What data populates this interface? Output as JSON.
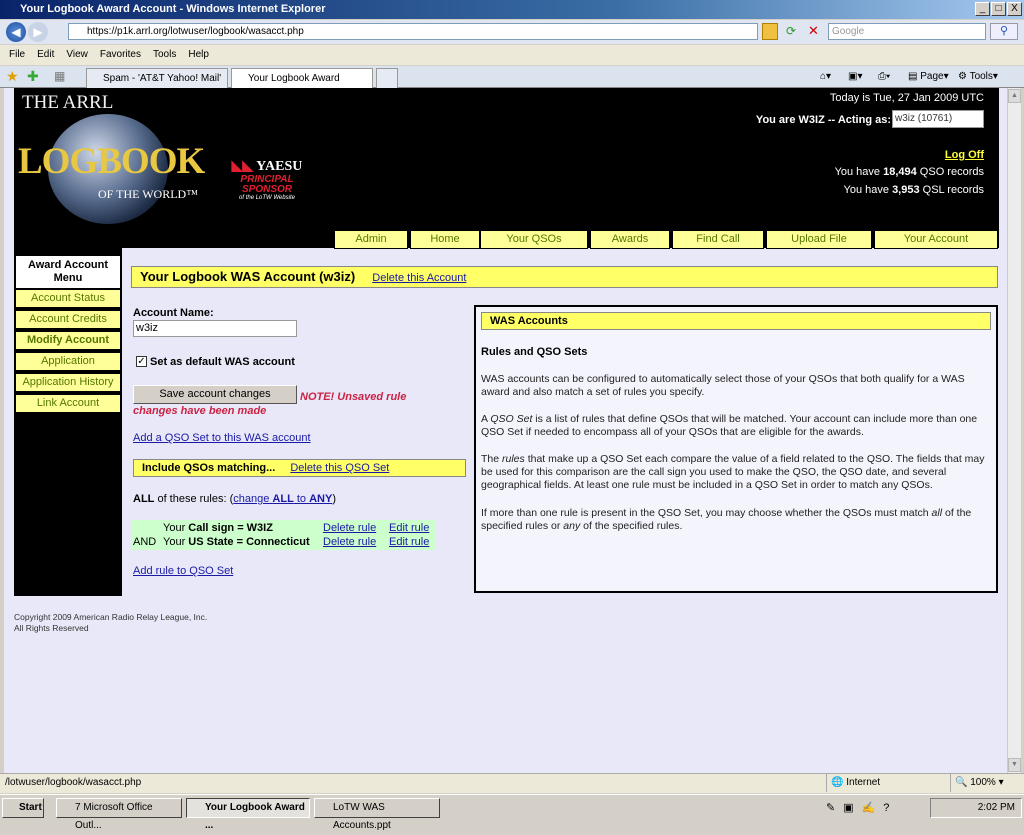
{
  "window": {
    "title": "Your Logbook Award Account - Windows Internet Explorer",
    "url": "https://p1k.arrl.org/lotwuser/logbook/wasacct.php",
    "search_placeholder": "Google"
  },
  "menu": [
    "File",
    "Edit",
    "View",
    "Favorites",
    "Tools",
    "Help"
  ],
  "tabs": [
    {
      "label": "Spam - 'AT&T Yahoo! Mail'"
    },
    {
      "label": "Your Logbook Award Acc..."
    }
  ],
  "command_bar": {
    "page": "Page",
    "tools": "Tools"
  },
  "header": {
    "logo_text": "THE ARRL LOGBOOK OF THE WORLD",
    "sponsor": "YAESU PRINCIPAL SPONSOR of the LoTW Website",
    "today": "Today is Tue, 27 Jan 2009 UTC",
    "you_are": "You are W3IZ -- Acting as:",
    "acting_as": "w3iz  (10761)",
    "log_off": "Log Off",
    "qso_prefix": "You have ",
    "qso_count": "18,494",
    "qso_suffix": " QSO records",
    "qsl_prefix": "You have ",
    "qsl_count": "3,953",
    "qsl_suffix": " QSL records"
  },
  "nav": [
    "Admin",
    "Home",
    "Your QSOs",
    "Awards",
    "Find Call",
    "Upload File",
    "Your Account"
  ],
  "sidebar": {
    "title": "Award Account Menu",
    "items": [
      "Account Status",
      "Account Credits",
      "Modify Account",
      "Application",
      "Application History",
      "Link Account"
    ],
    "active": "Modify Account"
  },
  "main": {
    "title": "Your Logbook WAS Account (w3iz)",
    "delete_account": "Delete this Account",
    "account_name_label": "Account Name:",
    "account_name_value": "w3iz",
    "default_checkbox_label": "Set as default WAS account",
    "default_checked": true,
    "save_button": "Save account changes",
    "note": "NOTE! Unsaved rule changes have been made",
    "add_qso_set": "Add a QSO Set to this WAS account",
    "qso_set_title": "Include QSOs matching...",
    "delete_qso_set": "Delete this QSO Set",
    "all_label": "ALL",
    "rules_text": " of these rules: (",
    "change_link_pre": "change ",
    "change_all": "ALL",
    "change_to": " to ",
    "change_any": "ANY",
    "rules_close": ")",
    "rules": [
      {
        "conj": "",
        "prefix": "Your ",
        "field": "Call sign = W3IZ",
        "delete": "Delete rule",
        "edit": "Edit rule"
      },
      {
        "conj": "AND",
        "prefix": "Your ",
        "field": "US State = Connecticut",
        "delete": "Delete rule",
        "edit": "Edit rule"
      }
    ],
    "add_rule": "Add rule to QSO Set"
  },
  "help": {
    "title": "WAS Accounts",
    "subtitle": "Rules and QSO Sets",
    "p1": "WAS accounts can be configured to automatically select those of your QSOs that both qualify for a WAS award and also match a set of rules you specify.",
    "p2a": "A ",
    "p2i": "QSO Set",
    "p2b": " is a list of rules that define QSOs that will be matched. Your account can include more than one QSO Set if needed to encompass all of your QSOs that are eligible for the awards.",
    "p3a": "The ",
    "p3i": "rules",
    "p3b": " that make up a QSO Set each compare the value of a field related to the QSO. The fields that may be used for this comparison are the call sign you used to make the QSO, the QSO date, and several geographical fields. At least one rule must be included in a QSO Set in order to match any QSOs.",
    "p4a": "If more than one rule is present in the QSO Set, you may choose whether the QSOs must match ",
    "p4i": "all",
    "p4b": " of the specified rules or ",
    "p4i2": "any",
    "p4c": " of the specified rules."
  },
  "footer": {
    "copyright": "Copyright 2009 American Radio Relay League, Inc.",
    "rights": "All Rights Reserved"
  },
  "statusbar": {
    "url": "/lotwuser/logbook/wasacct.php",
    "zone": "Internet",
    "zoom": "100%"
  },
  "taskbar": {
    "start": "Start",
    "items": [
      "7 Microsoft Office Outl...",
      "Your Logbook Award ...",
      "LoTW WAS Accounts.ppt"
    ],
    "clock": "2:02 PM"
  },
  "colors": {
    "yellow": "#ffff99",
    "header_bg": "#000000",
    "page_bg": "#e8e8f8",
    "note": "#cc2244",
    "rules_bg": "#ccffcc"
  }
}
